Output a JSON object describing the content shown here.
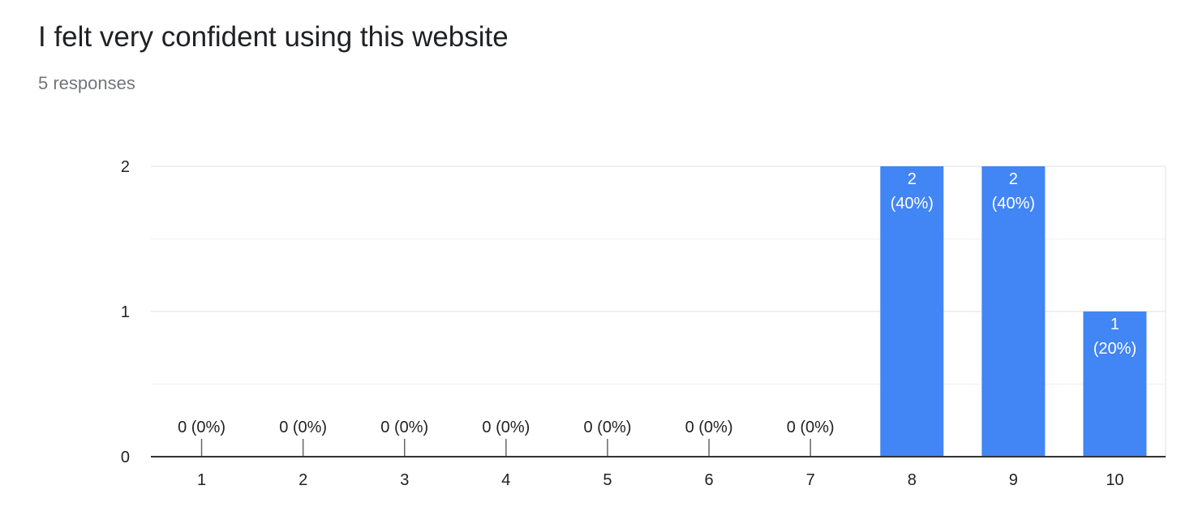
{
  "header": {
    "title": "I felt very confident using this website",
    "response_count": "5 responses"
  },
  "colors": {
    "bar": "#4285f4",
    "grid": "#ebebeb",
    "axis": "#333333",
    "label_inside": "#ffffff",
    "label_outside": "#222222"
  },
  "chart_data": {
    "type": "bar",
    "title": "I felt very confident using this website",
    "subtitle": "5 responses",
    "categories": [
      "1",
      "2",
      "3",
      "4",
      "5",
      "6",
      "7",
      "8",
      "9",
      "10"
    ],
    "values": [
      0,
      0,
      0,
      0,
      0,
      0,
      0,
      2,
      2,
      1
    ],
    "data_labels": [
      "0 (0%)",
      "0 (0%)",
      "0 (0%)",
      "0 (0%)",
      "0 (0%)",
      "0 (0%)",
      "0 (0%)",
      "2 (40%)",
      "2 (40%)",
      "1 (20%)"
    ],
    "value_text": [
      "0",
      "0",
      "0",
      "0",
      "0",
      "0",
      "0",
      "2",
      "2",
      "1"
    ],
    "percent_text": [
      "(0%)",
      "(0%)",
      "(0%)",
      "(0%)",
      "(0%)",
      "(0%)",
      "(0%)",
      "(40%)",
      "(40%)",
      "(20%)"
    ],
    "y_ticks": [
      0,
      1,
      2
    ],
    "ylim": [
      0,
      2
    ],
    "xlabel": "",
    "ylabel": "",
    "grid": true,
    "minor_grid": true,
    "legend": "none"
  }
}
